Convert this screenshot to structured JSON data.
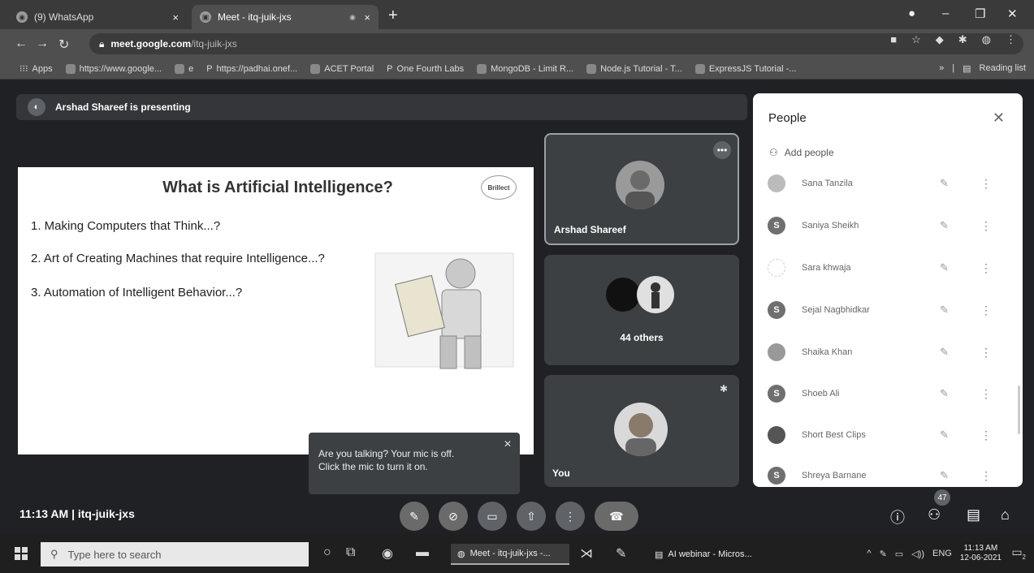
{
  "browser": {
    "tabs": [
      {
        "title": "(9) WhatsApp",
        "close": "×"
      },
      {
        "title": "Meet - itq-juik-jxs",
        "close": "×"
      }
    ],
    "new_tab": "+",
    "url_host": "meet.google.com",
    "url_path": "/itq-juik-jxs",
    "bookmarks": [
      "Apps",
      "https://www.google...",
      "e",
      "https://padhai.onef...",
      "ACET Portal",
      "One Fourth Labs",
      "MongoDB - Limit R...",
      "Node.js Tutorial - T...",
      "ExpressJS Tutorial -..."
    ],
    "bookmarks_more": "»",
    "reading_list": "Reading list"
  },
  "meet": {
    "presenting_banner": "Arshad Shareef is presenting",
    "slide": {
      "title": "What is Artificial Intelligence?",
      "points": [
        "1. Making Computers that Think...?",
        "2. Art of Creating Machines that require Intelligence...?",
        "3. Automation of Intelligent Behavior...?"
      ],
      "logo": "Brillect"
    },
    "tiles": {
      "presenter_name": "Arshad Shareef",
      "others": "44 others",
      "self_name": "You"
    },
    "toast": {
      "line1": "Are you talking? Your mic is off.",
      "line2": "Click the mic to turn it on."
    },
    "meeting_info": "11:13 AM  |  itq-juik-jxs",
    "participants_count": "47"
  },
  "people_panel": {
    "title": "People",
    "add_people": "Add people",
    "participants": [
      {
        "initial": "",
        "name": "Sana Tanzila"
      },
      {
        "initial": "S",
        "name": "Saniya Sheikh"
      },
      {
        "initial": "",
        "name": "Sara khwaja"
      },
      {
        "initial": "S",
        "name": "Sejal Nagbhidkar"
      },
      {
        "initial": "",
        "name": "Shaika Khan"
      },
      {
        "initial": "S",
        "name": "Shoeb Ali"
      },
      {
        "initial": "",
        "name": "Short Best Clips"
      },
      {
        "initial": "S",
        "name": "Shreya Barnane"
      }
    ]
  },
  "taskbar": {
    "search_placeholder": "Type here to search",
    "apps": [
      "Meet - itq-juik-jxs -...",
      "AI webinar - Micros..."
    ],
    "lang": "ENG",
    "time": "11:13 AM",
    "date": "12-06-2021",
    "notifications": "2"
  }
}
